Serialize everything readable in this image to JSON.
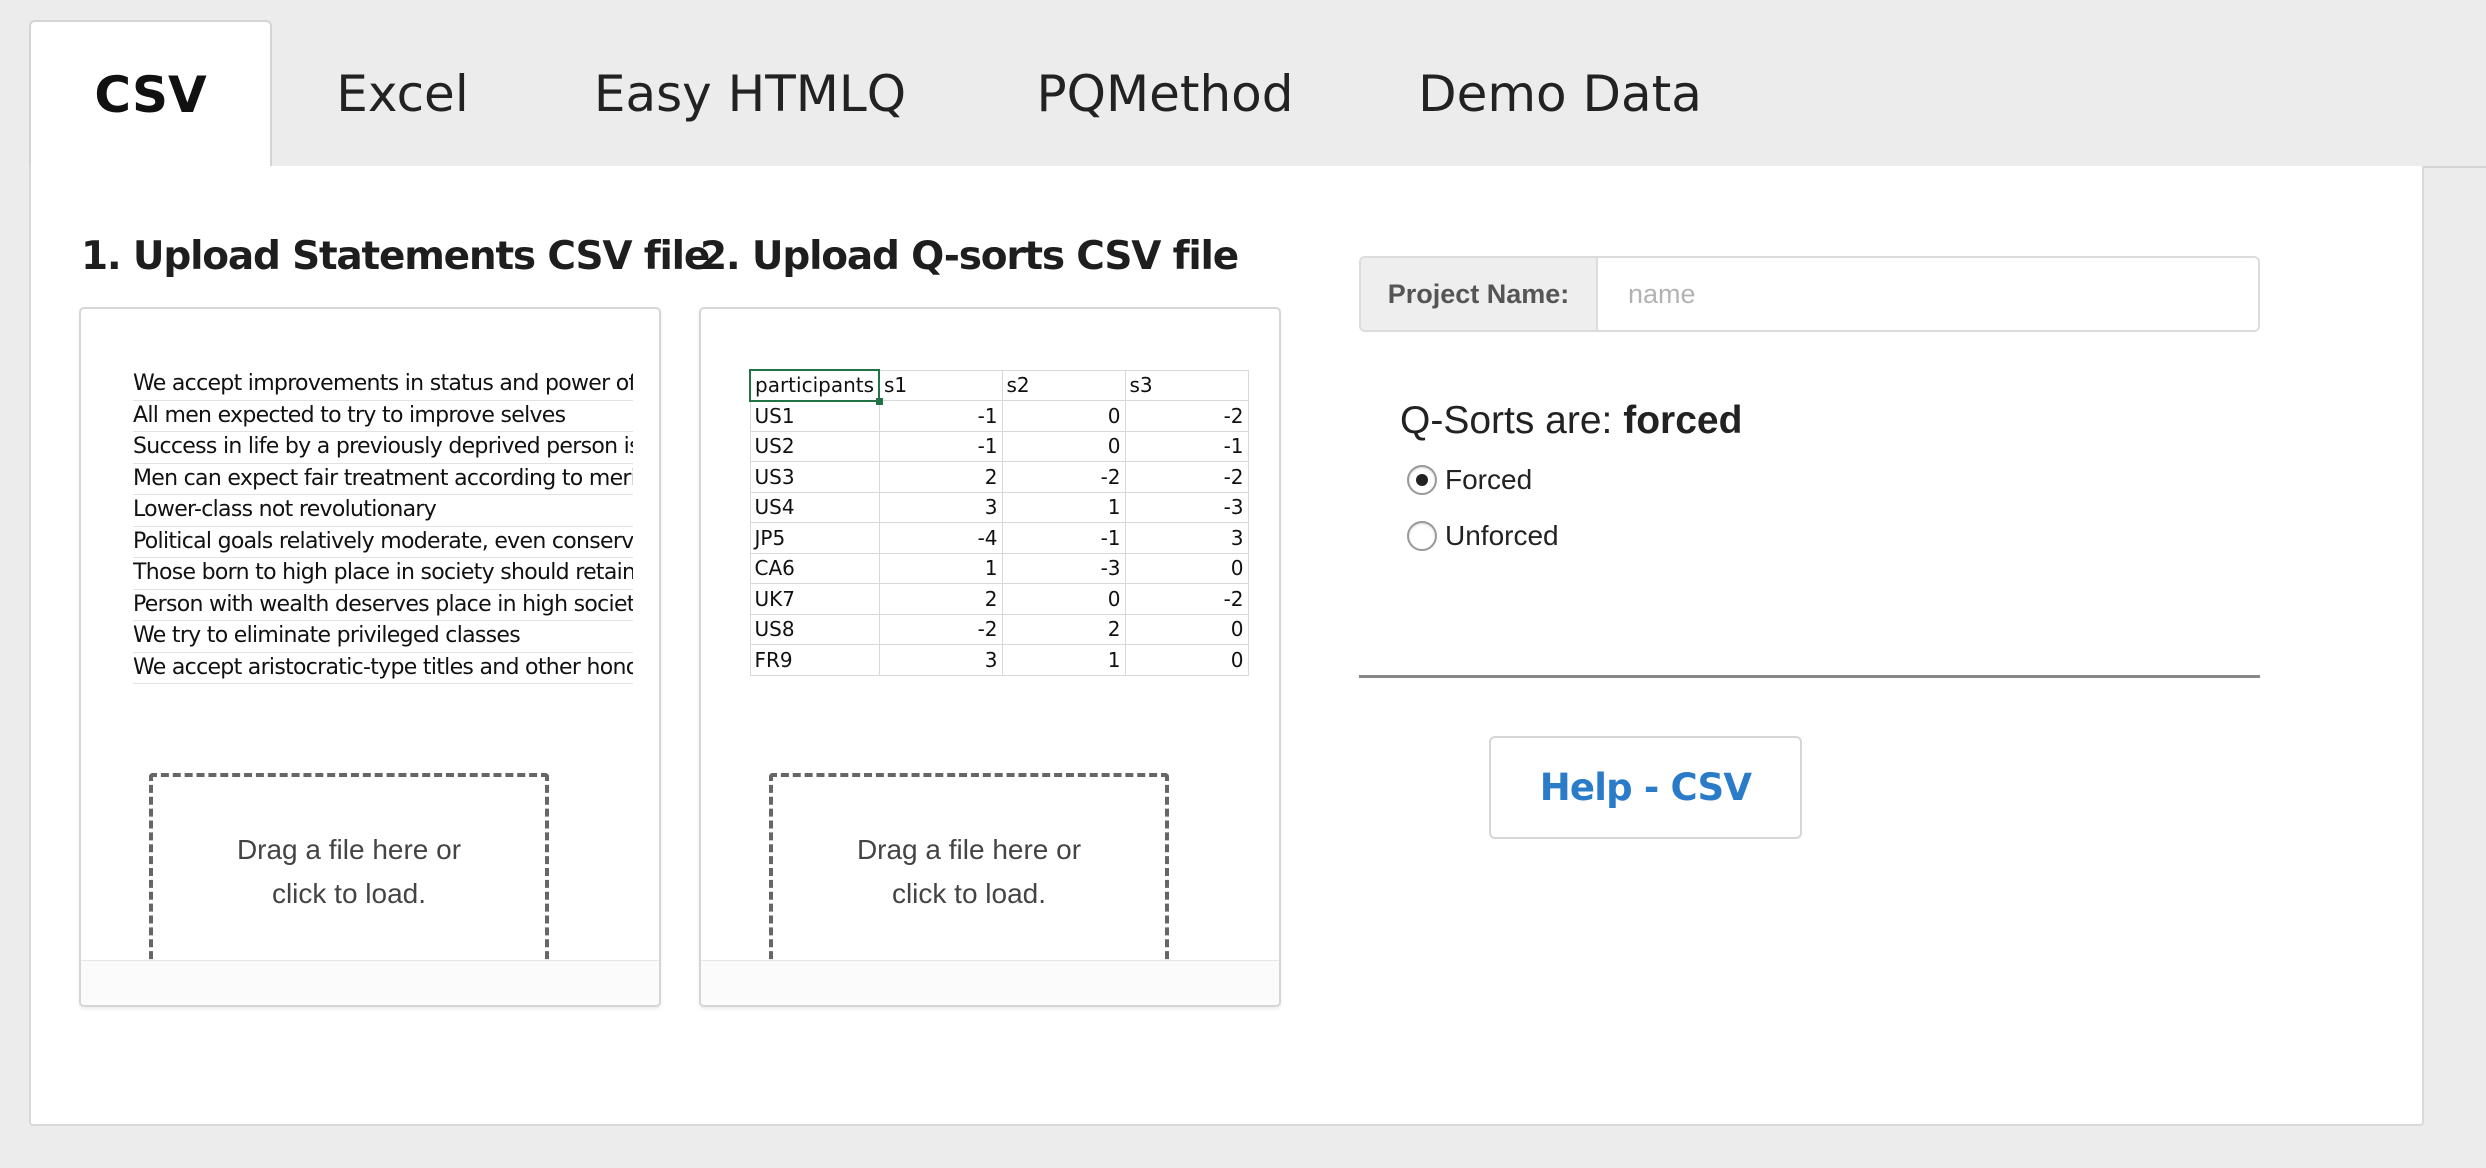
{
  "tabs": [
    {
      "label": "CSV",
      "active": true
    },
    {
      "label": "Excel",
      "active": false
    },
    {
      "label": "Easy HTMLQ",
      "active": false
    },
    {
      "label": "PQMethod",
      "active": false
    },
    {
      "label": "Demo Data",
      "active": false
    }
  ],
  "statements_upload": {
    "title": "1. Upload Statements CSV file",
    "preview_statements": [
      "We accept improvements in status and power of lo",
      "All men expected to try to improve selves",
      "Success in life by a previously deprived person is re",
      "Men can expect fair treatment according to merit",
      "Lower-class not revolutionary",
      "Political goals relatively moderate, even conservat",
      "Those born to high place in society should retain it",
      "Person with wealth deserves place in high society",
      "We try to eliminate privileged classes",
      "We accept aristocratic-type titles and other honors"
    ],
    "dropzone_line1": "Drag a file here or",
    "dropzone_line2": "click to load."
  },
  "qsorts_upload": {
    "title": "2. Upload Q-sorts CSV file",
    "preview_table": {
      "headers": [
        "participants",
        "s1",
        "s2",
        "s3"
      ],
      "rows": [
        [
          "US1",
          "-1",
          "0",
          "-2"
        ],
        [
          "US2",
          "-1",
          "0",
          "-1"
        ],
        [
          "US3",
          "2",
          "-2",
          "-2"
        ],
        [
          "US4",
          "3",
          "1",
          "-3"
        ],
        [
          "JP5",
          "-4",
          "-1",
          "3"
        ],
        [
          "CA6",
          "1",
          "-3",
          "0"
        ],
        [
          "UK7",
          "2",
          "0",
          "-2"
        ],
        [
          "US8",
          "-2",
          "2",
          "0"
        ],
        [
          "FR9",
          "3",
          "1",
          "0"
        ]
      ]
    },
    "dropzone_line1": "Drag a file here or",
    "dropzone_line2": "click to load."
  },
  "project": {
    "label": "Project Name:",
    "value": "",
    "placeholder": "name"
  },
  "qsort_type": {
    "heading_prefix": "Q-Sorts are: ",
    "heading_value": "forced",
    "options": [
      {
        "label": "Forced",
        "selected": true
      },
      {
        "label": "Unforced",
        "selected": false
      }
    ]
  },
  "help_button": {
    "label": "Help - CSV"
  },
  "colors": {
    "accent_link": "#2a7bc8",
    "excel_selection": "#217346",
    "page_background": "#ececec"
  }
}
